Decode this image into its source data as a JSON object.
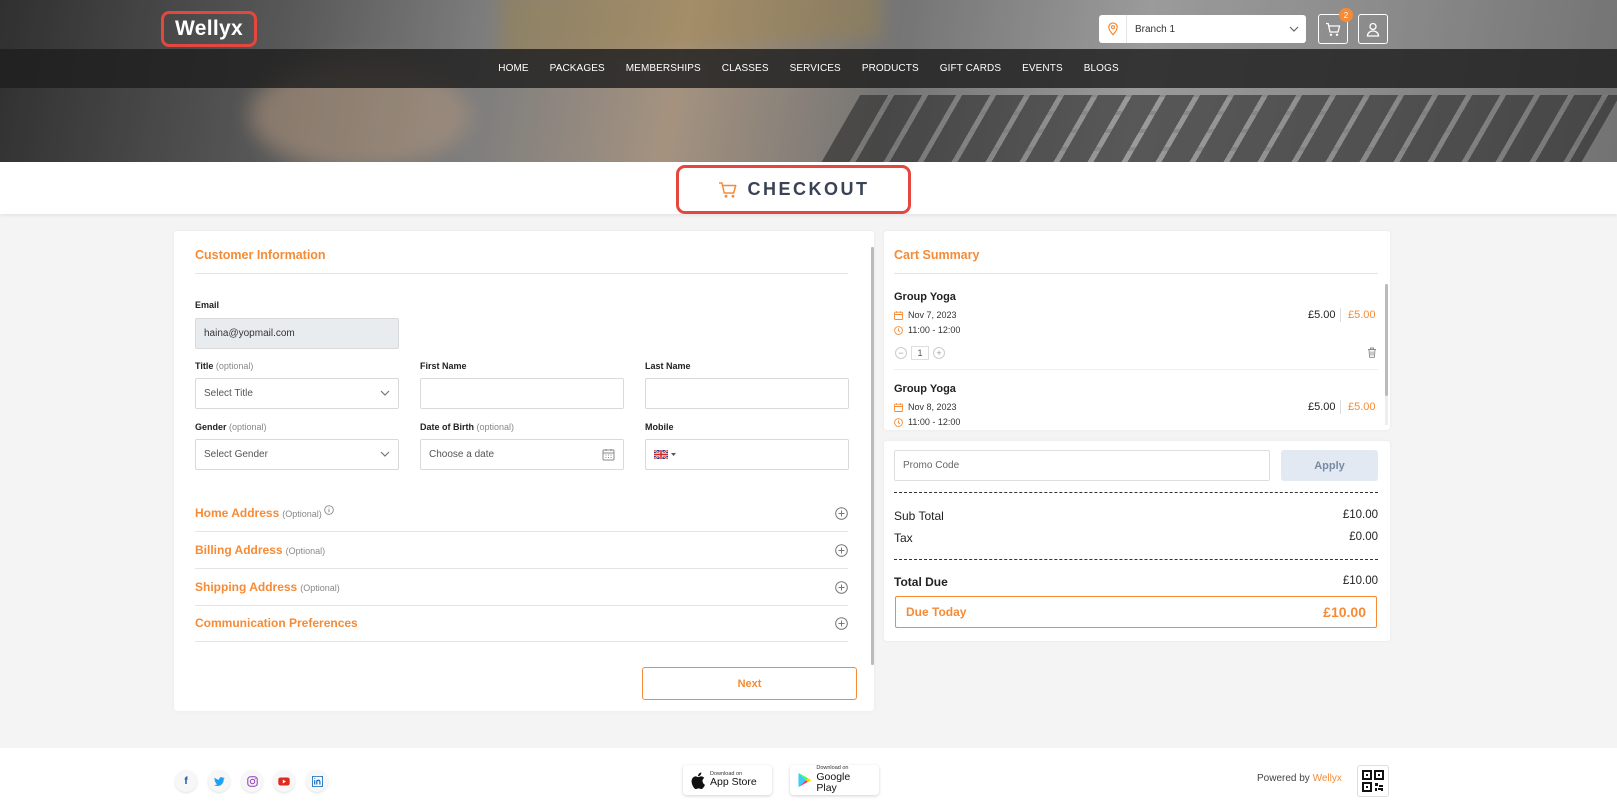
{
  "brand": {
    "logo_text": "Wellyx"
  },
  "header": {
    "branch": "Branch 1",
    "cart_count": "2"
  },
  "nav": {
    "items": [
      "HOME",
      "PACKAGES",
      "MEMBERSHIPS",
      "CLASSES",
      "SERVICES",
      "PRODUCTS",
      "GIFT CARDS",
      "EVENTS",
      "BLOGS"
    ]
  },
  "page": {
    "title": "CHECKOUT"
  },
  "customer": {
    "section_title": "Customer Information",
    "email_label": "Email",
    "email_value": "haina@yopmail.com",
    "title_label": "Title",
    "title_opt": "(optional)",
    "title_value": "Select Title",
    "first_name_label": "First Name",
    "last_name_label": "Last Name",
    "gender_label": "Gender",
    "gender_opt": "(optional)",
    "gender_value": "Select Gender",
    "dob_label": "Date of Birth",
    "dob_opt": "(optional)",
    "dob_placeholder": "Choose a date",
    "mobile_label": "Mobile",
    "accordions": [
      {
        "title": "Home Address",
        "opt": "(Optional)"
      },
      {
        "title": "Billing Address",
        "opt": "(Optional)"
      },
      {
        "title": "Shipping Address",
        "opt": "(Optional)"
      },
      {
        "title": "Communication Preferences",
        "opt": ""
      }
    ],
    "next_label": "Next"
  },
  "cart": {
    "section_title": "Cart Summary",
    "items": [
      {
        "name": "Group Yoga",
        "date": "Nov 7, 2023",
        "time": "11:00 - 12:00",
        "price": "£5.00",
        "total": "£5.00",
        "qty": "1"
      },
      {
        "name": "Group Yoga",
        "date": "Nov 8, 2023",
        "time": "11:00 - 12:00",
        "price": "£5.00",
        "total": "£5.00"
      }
    ]
  },
  "totals": {
    "promo_placeholder": "Promo Code",
    "apply_label": "Apply",
    "subtotal_label": "Sub Total",
    "subtotal_value": "£10.00",
    "tax_label": "Tax",
    "tax_value": "£0.00",
    "total_due_label": "Total Due",
    "total_due_value": "£10.00",
    "due_today_label": "Due Today",
    "due_today_value": "£10.00"
  },
  "footer": {
    "app_store_small": "Download on",
    "app_store_big": "App Store",
    "play_small": "Download on",
    "play_big": "Google Play",
    "powered_by": "Powered by",
    "powered_brand": "Wellyx"
  },
  "colors": {
    "accent": "#f58b36",
    "highlight": "#e4473d",
    "heading": "#3a4256"
  }
}
